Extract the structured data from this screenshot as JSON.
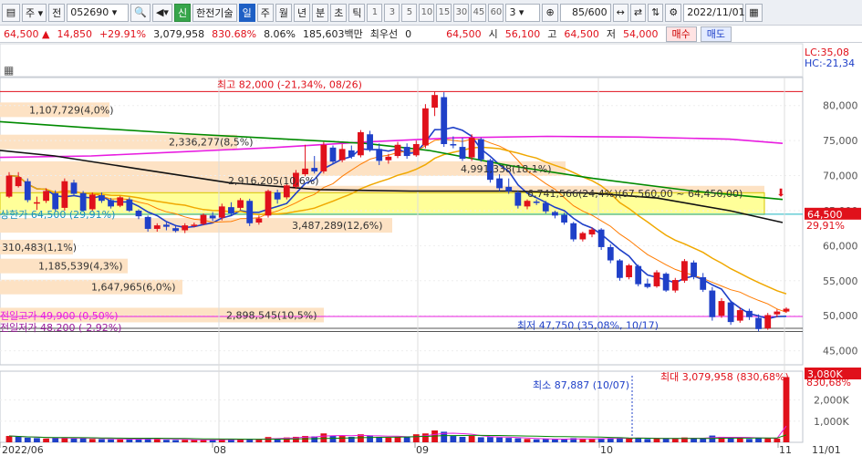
{
  "toolbar": {
    "market": "주",
    "period_type": "전",
    "code": "052690",
    "flag": "신",
    "name": "한전기술",
    "tabs": [
      "일",
      "주",
      "월",
      "년",
      "분",
      "초",
      "틱"
    ],
    "active_tab": "일",
    "intervals": [
      "1",
      "3",
      "5",
      "10",
      "15",
      "30",
      "45",
      "60"
    ],
    "interval_value": "3",
    "count": "85",
    "count_total": "/600",
    "date": "2022/11/01"
  },
  "quote": {
    "price": "64,500",
    "change": "14,850",
    "change_pct": "+29.91%",
    "volume": "3,079,958",
    "vol_ratio": "830.68%",
    "turnover": "8.06%",
    "amount": "185,603백만",
    "pref_label": "최우선",
    "pref_value": "0",
    "pref_price": "64,500",
    "open_label": "시",
    "open": "56,100",
    "high_label": "고",
    "high": "64,500",
    "low_label": "저",
    "low": "54,000",
    "buy_label": "매수",
    "sell_label": "매도"
  },
  "chart_labels": {
    "lc": "LC:35,08",
    "hc": "HC:-21,34",
    "high_note": "최고 82,000 (-21,34%, 08/26)",
    "low_note": "최저 47,750 (35,08%, 10/17)",
    "upper_limit": "상한가 64,500 (29,91%)",
    "prev_high": "전일고가 49,900 (0,50%)",
    "prev_low": "전일저가 48,200 (-2,92%)",
    "price_tag": "64,500",
    "pct_tag": "29,91%",
    "vol_tag": "3,080K",
    "vol_pct_tag": "830,68%",
    "vol_min_note": "최소 87,887 (10/07)",
    "vol_max_note": "최대 3,079,958 (830,68%)",
    "profile": [
      {
        "label": "1,107,729(4,0%)",
        "price": 79400,
        "width": 120
      },
      {
        "label": "2,336,277(8,5%)",
        "price": 74800,
        "width": 260
      },
      {
        "label": "4,991,338(18,1%)",
        "price": 71000,
        "width": 620
      },
      {
        "label": "2,916,205(10,6%)",
        "price": 69300,
        "width": 320
      },
      {
        "label": "6,741,566(24,4%)(67,560,00 ~ 64,450,00)",
        "price": 67500,
        "width": 838
      },
      {
        "label": "3,487,289(12,6%)",
        "price": 62900,
        "width": 430
      },
      {
        "label": "310,483(1,1%)",
        "price": 59800,
        "width": 80
      },
      {
        "label": "1,185,539(4,3%)",
        "price": 57100,
        "width": 140
      },
      {
        "label": "1,647,965(6,0%)",
        "price": 54100,
        "width": 200
      },
      {
        "label": "2,898,545(10,5%)",
        "price": 50100,
        "width": 355
      }
    ]
  },
  "axes": {
    "price_ticks": [
      "80,000",
      "75,000",
      "70,000",
      "65,000",
      "60,000",
      "55,000",
      "50,000",
      "45,000"
    ],
    "volume_ticks": [
      "2,000K",
      "1,000K"
    ],
    "date_labels": [
      "2022/06",
      "08",
      "09",
      "10",
      "11",
      "11/01"
    ]
  },
  "colors": {
    "up": "#e0111b",
    "down": "#1f40c8",
    "ma5": "#1f40c8",
    "ma20": "#ff7b00",
    "ma60": "#f0a800",
    "ma120": "#111111",
    "ma240": "#008a00",
    "ma480": "#e81ce0",
    "profile": "#fde2c4",
    "band": "#ffff99"
  },
  "chart_data": {
    "type": "candlestick",
    "ylim": [
      43000,
      84000
    ],
    "vol_max": 3100000,
    "candles": [
      [
        67000,
        70500,
        66800,
        70000
      ],
      [
        68500,
        70500,
        68300,
        69800
      ],
      [
        69200,
        69600,
        66200,
        66500
      ],
      [
        66000,
        67000,
        65100,
        66200
      ],
      [
        66400,
        68200,
        66100,
        67800
      ],
      [
        67500,
        67900,
        64900,
        65200
      ],
      [
        65400,
        69600,
        65000,
        69200
      ],
      [
        69000,
        69400,
        67100,
        67400
      ],
      [
        67500,
        67800,
        64800,
        65000
      ],
      [
        65200,
        67600,
        65000,
        67300
      ],
      [
        67200,
        67600,
        66100,
        66400
      ],
      [
        66500,
        66800,
        65300,
        65600
      ],
      [
        65700,
        67100,
        65500,
        66900
      ],
      [
        66600,
        66900,
        64800,
        65000
      ],
      [
        65000,
        65200,
        63800,
        64200
      ],
      [
        64100,
        64300,
        62000,
        62400
      ],
      [
        62400,
        63200,
        62000,
        62900
      ],
      [
        63000,
        63300,
        62200,
        62700
      ],
      [
        62500,
        62800,
        61900,
        62100
      ],
      [
        62200,
        63200,
        61800,
        62900
      ],
      [
        62800,
        63300,
        62600,
        63000
      ],
      [
        63100,
        64600,
        62900,
        64400
      ],
      [
        64300,
        64800,
        63500,
        63900
      ],
      [
        64000,
        66000,
        63600,
        65600
      ],
      [
        65500,
        66200,
        64300,
        64600
      ],
      [
        65400,
        66800,
        65100,
        66500
      ],
      [
        66400,
        66700,
        62800,
        63200
      ],
      [
        63300,
        64300,
        63000,
        63900
      ],
      [
        64300,
        68000,
        64000,
        67800
      ],
      [
        67600,
        68000,
        66000,
        66600
      ],
      [
        66900,
        68900,
        66600,
        68600
      ],
      [
        68400,
        70800,
        68100,
        70400
      ],
      [
        70200,
        74400,
        69900,
        71000
      ],
      [
        71100,
        72800,
        70300,
        70600
      ],
      [
        70600,
        74800,
        70300,
        74400
      ],
      [
        74000,
        74300,
        71600,
        72000
      ],
      [
        72200,
        74500,
        71900,
        73800
      ],
      [
        73600,
        74300,
        72400,
        72700
      ],
      [
        72900,
        76500,
        72600,
        76200
      ],
      [
        75900,
        76400,
        73400,
        73800
      ],
      [
        73800,
        74600,
        71500,
        72100
      ],
      [
        72200,
        73100,
        71700,
        72700
      ],
      [
        72800,
        74800,
        72500,
        74400
      ],
      [
        74100,
        74600,
        72400,
        72800
      ],
      [
        72900,
        75000,
        72700,
        74500
      ],
      [
        74300,
        80200,
        73900,
        79600
      ],
      [
        79700,
        82000,
        78500,
        81500
      ],
      [
        81200,
        81900,
        74100,
        74500
      ],
      [
        74500,
        75600,
        73900,
        74300
      ],
      [
        74100,
        75400,
        72100,
        72400
      ],
      [
        72600,
        75900,
        72100,
        75400
      ],
      [
        75200,
        75400,
        72000,
        72300
      ],
      [
        72200,
        72400,
        69000,
        69400
      ],
      [
        69600,
        70200,
        67800,
        68200
      ],
      [
        68400,
        69600,
        67400,
        67800
      ],
      [
        67600,
        67900,
        65300,
        65700
      ],
      [
        65600,
        66600,
        65200,
        66400
      ],
      [
        66300,
        66600,
        65800,
        66100
      ],
      [
        66100,
        66400,
        64600,
        64900
      ],
      [
        64800,
        65000,
        63900,
        64300
      ],
      [
        64400,
        64700,
        63000,
        63300
      ],
      [
        63200,
        63400,
        60600,
        60900
      ],
      [
        60900,
        62000,
        60600,
        61800
      ],
      [
        61600,
        62600,
        61200,
        62300
      ],
      [
        62300,
        62500,
        59400,
        59800
      ],
      [
        59800,
        60200,
        57500,
        57900
      ],
      [
        57900,
        58100,
        55000,
        55400
      ],
      [
        55500,
        57400,
        55200,
        57200
      ],
      [
        57100,
        57300,
        54200,
        54500
      ],
      [
        54600,
        55300,
        53900,
        54100
      ],
      [
        54200,
        56500,
        54000,
        56200
      ],
      [
        56000,
        56200,
        53400,
        53600
      ],
      [
        53600,
        55400,
        53300,
        55100
      ],
      [
        55000,
        58100,
        54700,
        57800
      ],
      [
        57600,
        57900,
        55200,
        55600
      ],
      [
        55500,
        56100,
        53400,
        53700
      ],
      [
        53600,
        54100,
        49300,
        49800
      ],
      [
        50000,
        52500,
        49700,
        52100
      ],
      [
        51900,
        52200,
        48700,
        49100
      ],
      [
        49300,
        51200,
        49000,
        50800
      ],
      [
        50700,
        51000,
        49400,
        49800
      ],
      [
        49700,
        50200,
        47750,
        48100
      ],
      [
        48200,
        50400,
        48000,
        50100
      ],
      [
        50200,
        50900,
        49800,
        50600
      ],
      [
        50600,
        51200,
        50400,
        51000
      ]
    ]
  }
}
